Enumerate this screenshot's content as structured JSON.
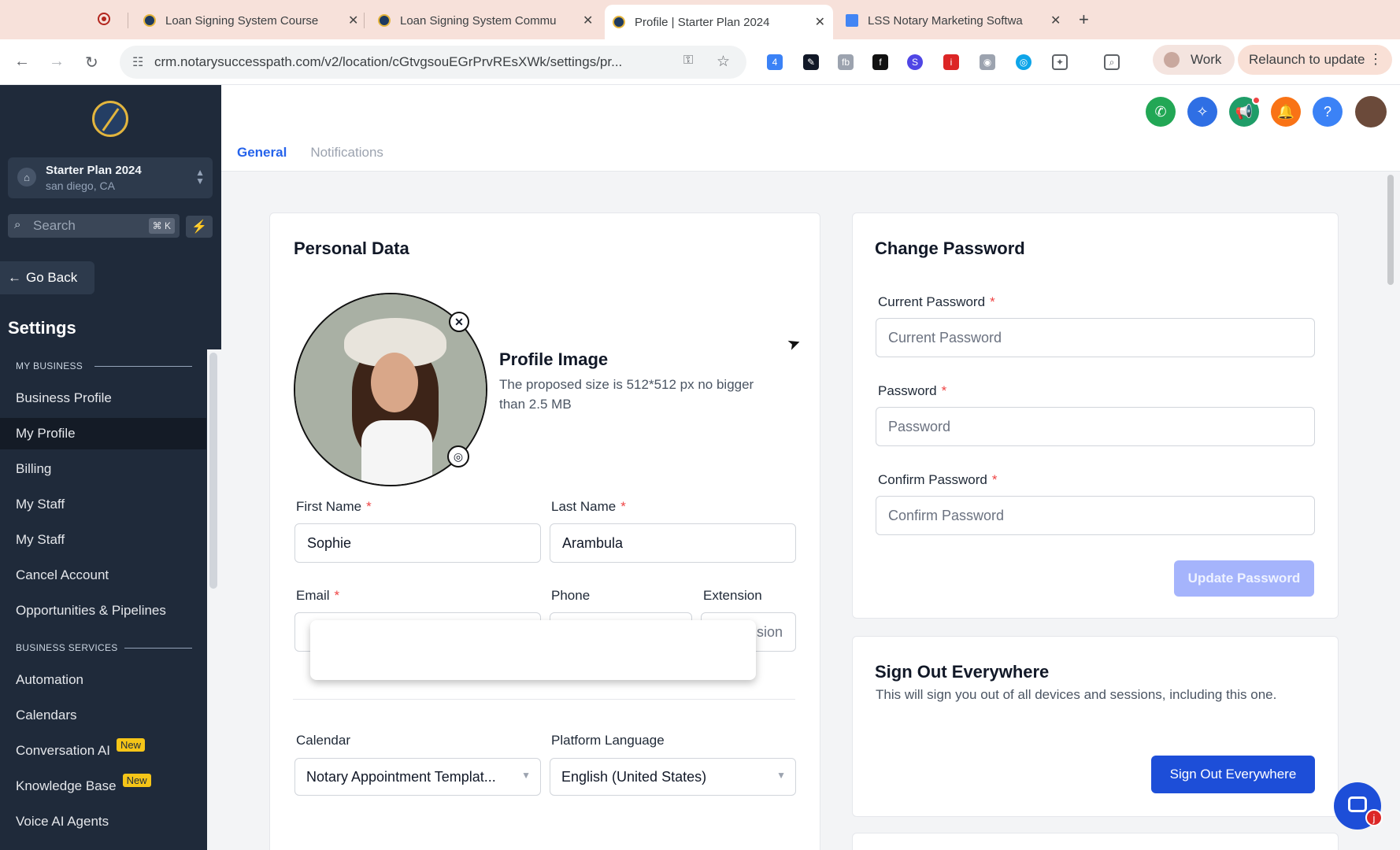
{
  "browser": {
    "tabs": [
      {
        "title": "Loan Signing System Course",
        "close": "✕"
      },
      {
        "title": "Loan Signing System Commu",
        "close": "✕"
      },
      {
        "title": "Profile | Starter Plan 2024",
        "close": "✕"
      },
      {
        "title": "LSS Notary Marketing Softwa",
        "close": "✕"
      }
    ],
    "new_tab": "+",
    "url": "crm.notarysuccesspath.com/v2/location/cGtvgsouEGrPrvREsXWk/settings/pr...",
    "ext_badge": "4",
    "profile_name": "Work",
    "relaunch_label": "Relaunch to update"
  },
  "sidebar": {
    "account_name": "Starter Plan 2024",
    "account_location": "san diego, CA",
    "search_placeholder": "Search",
    "search_shortcut": "⌘ K",
    "go_back": "Go Back",
    "title": "Settings",
    "sections": {
      "my_business": "MY BUSINESS",
      "business_services": "BUSINESS SERVICES"
    },
    "items": [
      {
        "label": "Business Profile"
      },
      {
        "label": "My Profile"
      },
      {
        "label": "Billing"
      },
      {
        "label": "My Staff"
      },
      {
        "label": "My Staff"
      },
      {
        "label": "Cancel Account"
      },
      {
        "label": "Opportunities & Pipelines"
      },
      {
        "label": "Automation"
      },
      {
        "label": "Calendars"
      },
      {
        "label": "Conversation AI",
        "badge": "New"
      },
      {
        "label": "Knowledge Base",
        "badge": "New"
      },
      {
        "label": "Voice AI Agents"
      }
    ],
    "active_item": "My Profile"
  },
  "header": {
    "tabs": [
      "General",
      "Notifications"
    ],
    "active_tab": "General",
    "icons": [
      "phone-icon",
      "sparkle-icon",
      "megaphone-icon",
      "bell-icon",
      "help-icon"
    ],
    "icon_colors": [
      "#22a755",
      "#2f6fe4",
      "#1f9d68",
      "#f97316",
      "#3b82f6"
    ]
  },
  "personal": {
    "title": "Personal Data",
    "profile_image_title": "Profile Image",
    "profile_image_desc": "The proposed size is 512*512 px no bigger than 2.5 MB",
    "first_name_label": "First Name",
    "first_name_value": "Sophie",
    "last_name_label": "Last Name",
    "last_name_value": "Arambula",
    "email_label": "Email",
    "phone_label": "Phone",
    "extension_label": "Extension",
    "extension_placeholder_visible": "sion",
    "required_mark": "*",
    "calendar_label": "Calendar",
    "calendar_value": "Notary Appointment Templat...",
    "language_label": "Platform Language",
    "language_value": "English (United States)"
  },
  "password": {
    "title": "Change Password",
    "current_label": "Current Password",
    "current_placeholder": "Current Password",
    "password_label": "Password",
    "password_placeholder": "Password",
    "confirm_label": "Confirm Password",
    "confirm_placeholder": "Confirm Password",
    "update_button": "Update Password"
  },
  "signout": {
    "title": "Sign Out Everywhere",
    "description": "This will sign you out of all devices and sessions, including this one.",
    "button": "Sign Out Everywhere"
  },
  "chat_widget": {
    "badge": "j"
  }
}
